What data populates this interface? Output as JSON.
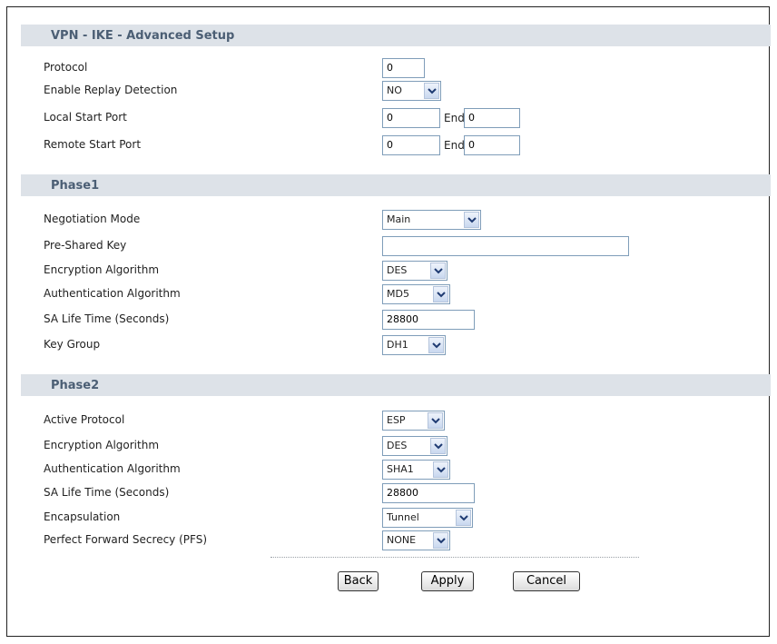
{
  "sections": [
    {
      "title": "VPN - IKE - Advanced Setup",
      "rows": [
        {
          "label": "Protocol",
          "value": "0"
        },
        {
          "label": "Enable Replay Detection",
          "value": "NO"
        },
        {
          "label": "Local Start Port",
          "start": "0",
          "end_label": "End",
          "end": "0"
        },
        {
          "label": "Remote Start Port",
          "start": "0",
          "end_label": "End",
          "end": "0"
        }
      ]
    },
    {
      "title": "Phase1",
      "rows": [
        {
          "label": "Negotiation Mode",
          "value": "Main"
        },
        {
          "label": "Pre-Shared Key",
          "value": ""
        },
        {
          "label": "Encryption Algorithm",
          "value": "DES"
        },
        {
          "label": "Authentication Algorithm",
          "value": "MD5"
        },
        {
          "label": "SA Life Time (Seconds)",
          "value": "28800"
        },
        {
          "label": "Key Group",
          "value": "DH1"
        }
      ]
    },
    {
      "title": "Phase2",
      "rows": [
        {
          "label": "Active Protocol",
          "value": "ESP"
        },
        {
          "label": "Encryption Algorithm",
          "value": "DES"
        },
        {
          "label": "Authentication Algorithm",
          "value": "SHA1"
        },
        {
          "label": "SA Life Time (Seconds)",
          "value": "28800"
        },
        {
          "label": "Encapsulation",
          "value": "Tunnel"
        },
        {
          "label": "Perfect Forward Secrecy (PFS)",
          "value": "NONE"
        }
      ]
    }
  ],
  "buttons": {
    "back": "Back",
    "apply": "Apply",
    "cancel": "Cancel"
  },
  "colors": {
    "section_header_bg": "#dde2e8",
    "section_title": "#4b5e74",
    "input_border": "#7f9db9"
  }
}
